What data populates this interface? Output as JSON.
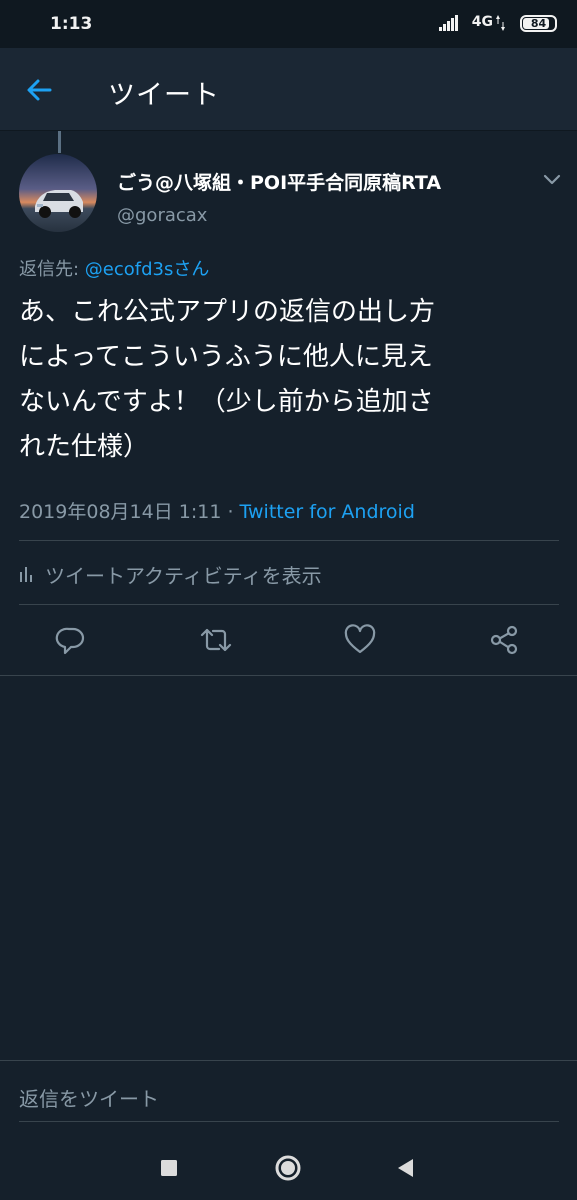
{
  "status_bar": {
    "time": "1:13",
    "network": "4G",
    "battery": "84",
    "battery_level": 0.84
  },
  "header": {
    "back_icon": "arrow-left-icon",
    "title": "ツイート"
  },
  "tweet": {
    "display_name": "ごう@八塚組・POI平手合同原稿RTA",
    "username": "@goracax",
    "reply_prefix": "返信先: ",
    "reply_mention": "@ecofd3sさん",
    "text_lines": [
      "あ、これ公式アプリの返信の出し方",
      "によってこういうふうに他人に見え",
      "ないんですよ！（少し前から追加さ",
      "れた仕様）"
    ],
    "timestamp": "2019年08月14日 1:11 · ",
    "source": "Twitter for Android",
    "activity_label": "ツイートアクティビティを表示"
  },
  "actions": [
    {
      "name": "reply-button",
      "icon": "reply-icon"
    },
    {
      "name": "retweet-button",
      "icon": "retweet-icon"
    },
    {
      "name": "like-button",
      "icon": "heart-icon"
    },
    {
      "name": "share-button",
      "icon": "share-icon"
    }
  ],
  "composer": {
    "placeholder": "返信をツイート"
  },
  "nav": {
    "recents": "square-icon",
    "home": "circle-icon",
    "back": "triangle-back-icon"
  },
  "colors": {
    "background": "#15202b",
    "header": "#1b2734",
    "accent": "#1da1f2",
    "secondary_text": "#8899a6",
    "divider": "#38444d"
  }
}
